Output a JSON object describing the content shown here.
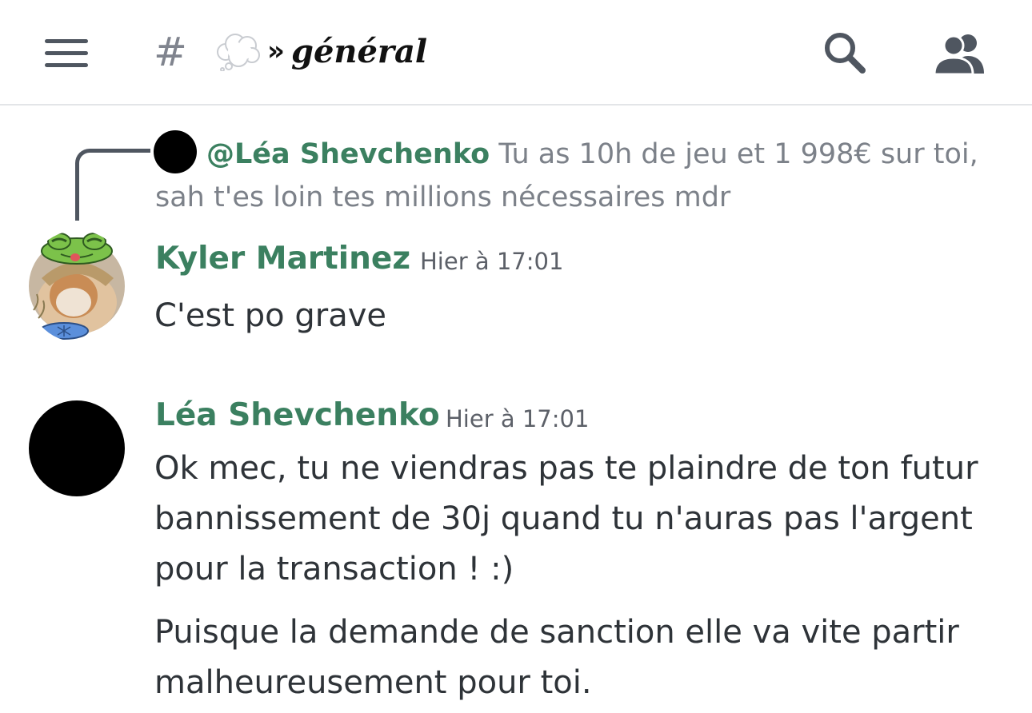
{
  "header": {
    "hash": "#",
    "channel_prefix_icon": "thought-balloon-icon",
    "channel_separator": "»",
    "channel_name": "𝒈é𝒏é𝒓𝒂𝒍",
    "icons": [
      "menu-icon",
      "search-icon",
      "members-icon"
    ]
  },
  "reply": {
    "author": "@Léa Shevchenko",
    "text": "Tu as 10h de jeu et 1 998€ sur toi, sah t'es loin tes millions nécessaires mdr"
  },
  "messages": [
    {
      "author": "Kyler Martinez",
      "timestamp": "Hier à 17:01",
      "lines": [
        "C'est po grave"
      ]
    },
    {
      "author": "Léa Shevchenko",
      "timestamp": "Hier à 17:01",
      "lines": [
        "Ok mec, tu ne viendras pas te plaindre de ton futur bannissement de 30j quand tu n'auras pas l'argent pour la transaction ! :)",
        "Puisque la demande de sanction elle va vite partir malheureusement pour toi."
      ]
    }
  ],
  "colors": {
    "username": "#3b8060",
    "text": "#2e3338",
    "muted": "#7c8189",
    "divider": "#e3e5e8"
  }
}
